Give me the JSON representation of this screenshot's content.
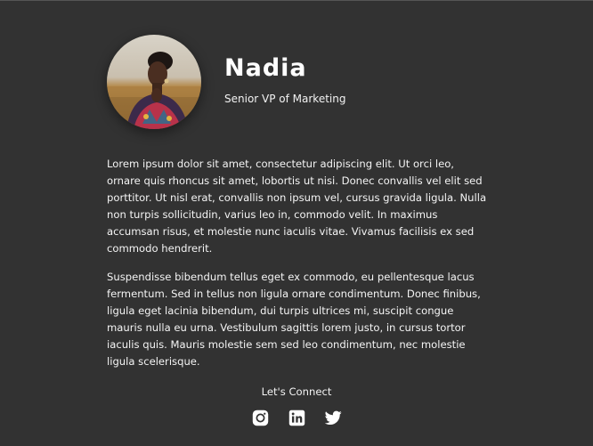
{
  "profile": {
    "name": "Nadia",
    "title": "Senior VP of Marketing"
  },
  "bio": {
    "paragraphs": [
      "Lorem ipsum dolor sit amet, consectetur adipiscing elit. Ut orci leo, ornare quis rhoncus sit amet, lobortis ut nisi. Donec convallis vel elit sed porttitor. Ut nisl erat, convallis non ipsum vel, cursus gravida ligula. Nulla non turpis sollicitudin, varius leo in, commodo velit. In maximus accumsan risus, et molestie nunc iaculis vitae. Vivamus facilisis ex sed commodo hendrerit.",
      "Suspendisse bibendum tellus eget ex commodo, eu pellentesque lacus fermentum. Sed in tellus non ligula ornare condimentum. Donec finibus, ligula eget lacinia bibendum, dui turpis ultrices mi, suscipit congue mauris nulla eu urna. Vestibulum sagittis lorem justo, in cursus tortor iaculis quis. Mauris molestie sem sed leo condimentum, nec molestie ligula scelerisque."
    ]
  },
  "connect": {
    "title": "Let's Connect",
    "links": [
      {
        "icon": "instagram-icon"
      },
      {
        "icon": "linkedin-icon"
      },
      {
        "icon": "twitter-icon"
      }
    ]
  },
  "colors": {
    "background": "#323232",
    "text": "#ffffff"
  }
}
